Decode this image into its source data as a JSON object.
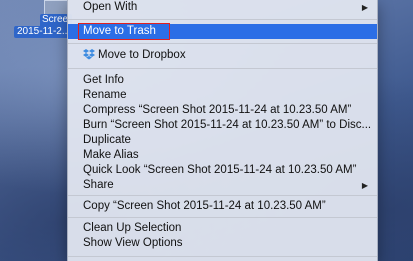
{
  "desktop": {
    "file_label_line1": "Scree",
    "file_label_line2": "2015-11-2..."
  },
  "menu": {
    "open_with": "Open With",
    "move_to_trash": "Move to Trash",
    "move_to_dropbox": "Move to Dropbox",
    "get_info": "Get Info",
    "rename": "Rename",
    "compress": "Compress “Screen Shot 2015-11-24 at 10.23.50 AM”",
    "burn": "Burn “Screen Shot 2015-11-24 at 10.23.50 AM” to Disc...",
    "duplicate": "Duplicate",
    "make_alias": "Make Alias",
    "quick_look": "Quick Look “Screen Shot 2015-11-24 at 10.23.50 AM”",
    "share": "Share",
    "copy": "Copy “Screen Shot 2015-11-24 at 10.23.50 AM”",
    "clean_up_selection": "Clean Up Selection",
    "show_view_options": "Show View Options"
  },
  "colors": {
    "highlight": "#2b6ee6",
    "annotation_box": "#e02020",
    "dropbox": "#3d8be0"
  }
}
